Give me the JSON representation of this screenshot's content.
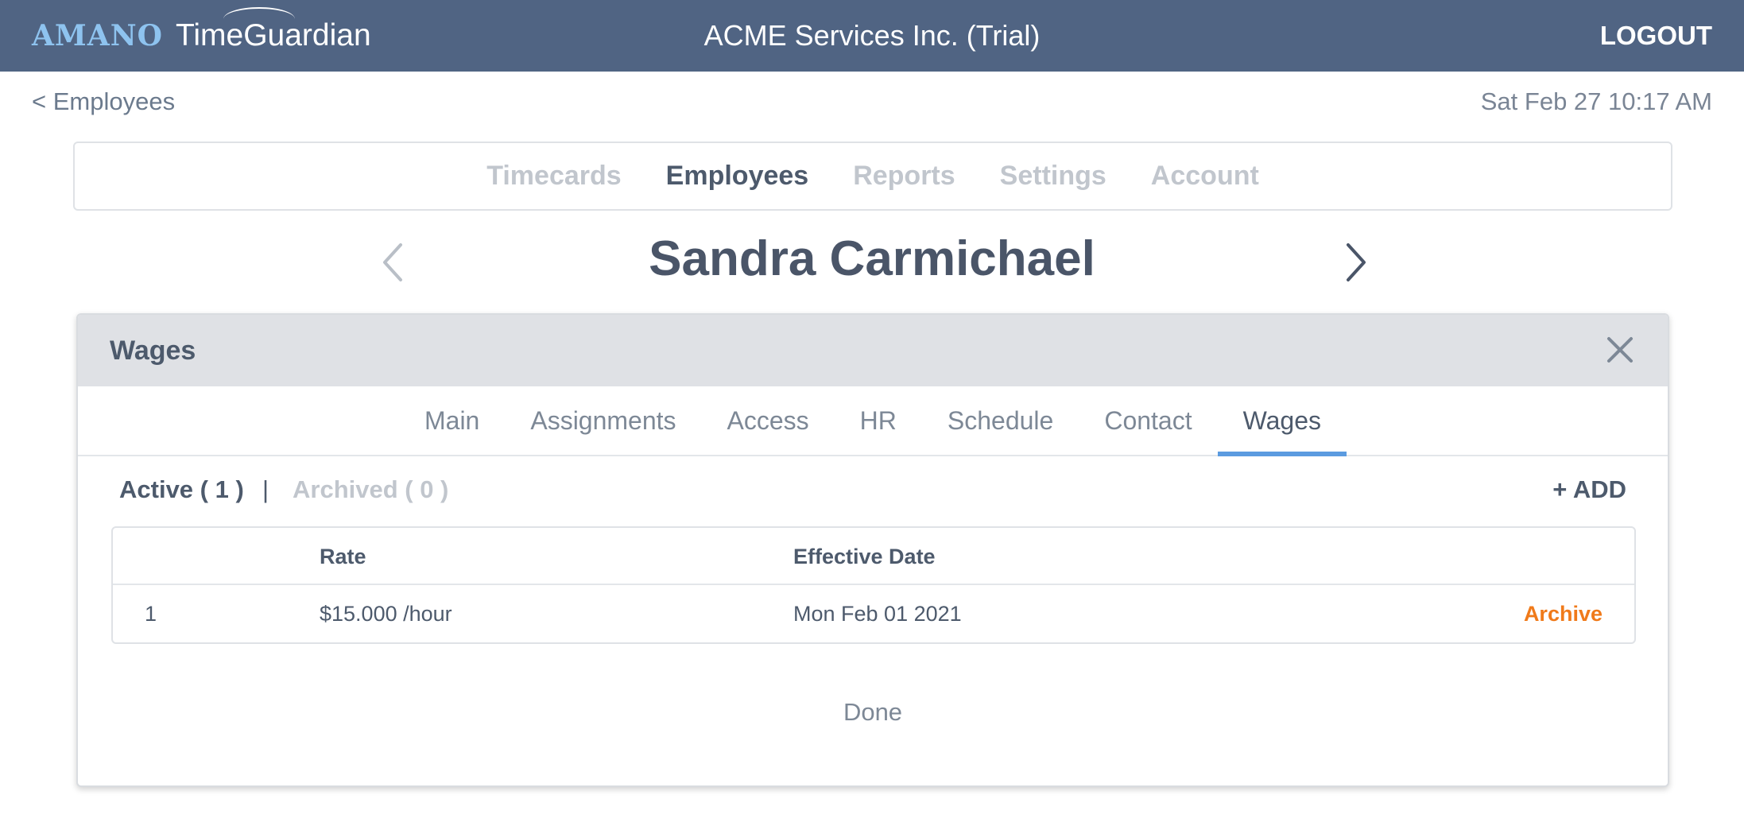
{
  "header": {
    "logo_brand": "AMANO",
    "logo_product": "TimeGuardian",
    "company": "ACME Services Inc. (Trial)",
    "logout": "LOGOUT"
  },
  "subheader": {
    "back": "< Employees",
    "datetime": "Sat Feb 27 10:17 AM"
  },
  "nav": {
    "items": [
      {
        "label": "Timecards",
        "active": false
      },
      {
        "label": "Employees",
        "active": true
      },
      {
        "label": "Reports",
        "active": false
      },
      {
        "label": "Settings",
        "active": false
      },
      {
        "label": "Account",
        "active": false
      }
    ]
  },
  "employee": {
    "name": "Sandra Carmichael",
    "prev_icon": "chevron-left-icon",
    "next_icon": "chevron-right-icon"
  },
  "panel": {
    "title": "Wages",
    "close_icon": "close-icon",
    "tabs": [
      {
        "label": "Main",
        "active": false
      },
      {
        "label": "Assignments",
        "active": false
      },
      {
        "label": "Access",
        "active": false
      },
      {
        "label": "HR",
        "active": false
      },
      {
        "label": "Schedule",
        "active": false
      },
      {
        "label": "Contact",
        "active": false
      },
      {
        "label": "Wages",
        "active": true
      }
    ],
    "filters": {
      "active": "Active ( 1 )",
      "separator": "|",
      "archived": "Archived ( 0 )",
      "add": "+ ADD"
    },
    "table": {
      "columns": {
        "rate": "Rate",
        "effective_date": "Effective Date"
      },
      "rows": [
        {
          "index": "1",
          "rate": "$15.000 /hour",
          "effective_date": "Mon Feb 01 2021",
          "action": "Archive"
        }
      ]
    },
    "done": "Done"
  },
  "colors": {
    "topbar": "#506483",
    "logo_brand": "#8ec3ef",
    "active_tab_underline": "#5b9be0",
    "archive_link": "#f07a1a"
  }
}
